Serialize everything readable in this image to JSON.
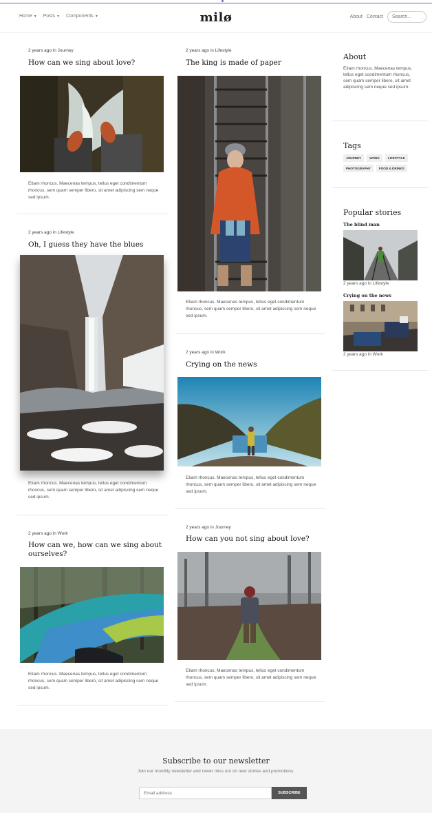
{
  "header": {
    "logo": "milø",
    "nav_left": [
      "Home",
      "Posts",
      "Components"
    ],
    "nav_right": [
      "About",
      "Contact"
    ],
    "search_placeholder": "Search..."
  },
  "posts": [
    {
      "meta": "2 years ago in Journey",
      "title": "How can we sing about love?",
      "excerpt": "Etiam rhoncus. Maecenas tempus, tellus eget condimentum rhoncus, sem quam semper libero, sit amet adipiscing sem neque sed ipsum."
    },
    {
      "meta": "2 years ago in Lifestyle",
      "title": "Oh, I guess they have the blues",
      "excerpt": "Etiam rhoncus. Maecenas tempus, tellus eget condimentum rhoncus, sem quam semper libero, sit amet adipiscing sem neque sed ipsum."
    },
    {
      "meta": "2 years ago in Work",
      "title": "How can we, how can we sing about ourselves?",
      "excerpt": "Etiam rhoncus. Maecenas tempus, tellus eget condimentum rhoncus, sem quam semper libero, sit amet adipiscing sem neque sed ipsum."
    },
    {
      "meta": "2 years ago in Lifestyle",
      "title": "The king is made of paper",
      "excerpt": "Etiam rhoncus. Maecenas tempus, tellus eget condimentum rhoncus, sem quam semper libero, sit amet adipiscing sem neque sed ipsum."
    },
    {
      "meta": "2 years ago in Work",
      "title": "Crying on the news",
      "excerpt": "Etiam rhoncus. Maecenas tempus, tellus eget condimentum rhoncus, sem quam semper libero, sit amet adipiscing sem neque sed ipsum."
    },
    {
      "meta": "2 years ago in Journey",
      "title": "How can you not sing about love?",
      "excerpt": "Etiam rhoncus. Maecenas tempus, tellus eget condimentum rhoncus, sem quam semper libero, sit amet adipiscing sem neque sed ipsum."
    }
  ],
  "sidebar": {
    "about_title": "About",
    "about_text": "Etiam rhoncus. Maecenas tempus, tellus eget condimentum rhoncus, sem quam semper libero, sit amet adipiscing sem neque sed ipsum.",
    "tags_title": "Tags",
    "tags": [
      "JOURNEY",
      "WORK",
      "LIFESTYLE",
      "PHOTOGRAPHY",
      "FOOD & DRINKS"
    ],
    "popular_title": "Popular stories",
    "popular": [
      {
        "title": "The blind man",
        "meta": "2 years ago in Lifestyle"
      },
      {
        "title": "Crying on the news",
        "meta": "2 years ago in Work"
      }
    ]
  },
  "newsletter": {
    "title": "Subscribe to our newsletter",
    "subtitle": "Join our monthly newsletter and never miss out on new stories and promotions.",
    "placeholder": "Email address",
    "button": "SUBSCRIBE"
  },
  "colors": {
    "accent": "#7a5ea8",
    "button": "#555555",
    "footer_bg": "#f4f4f4"
  }
}
